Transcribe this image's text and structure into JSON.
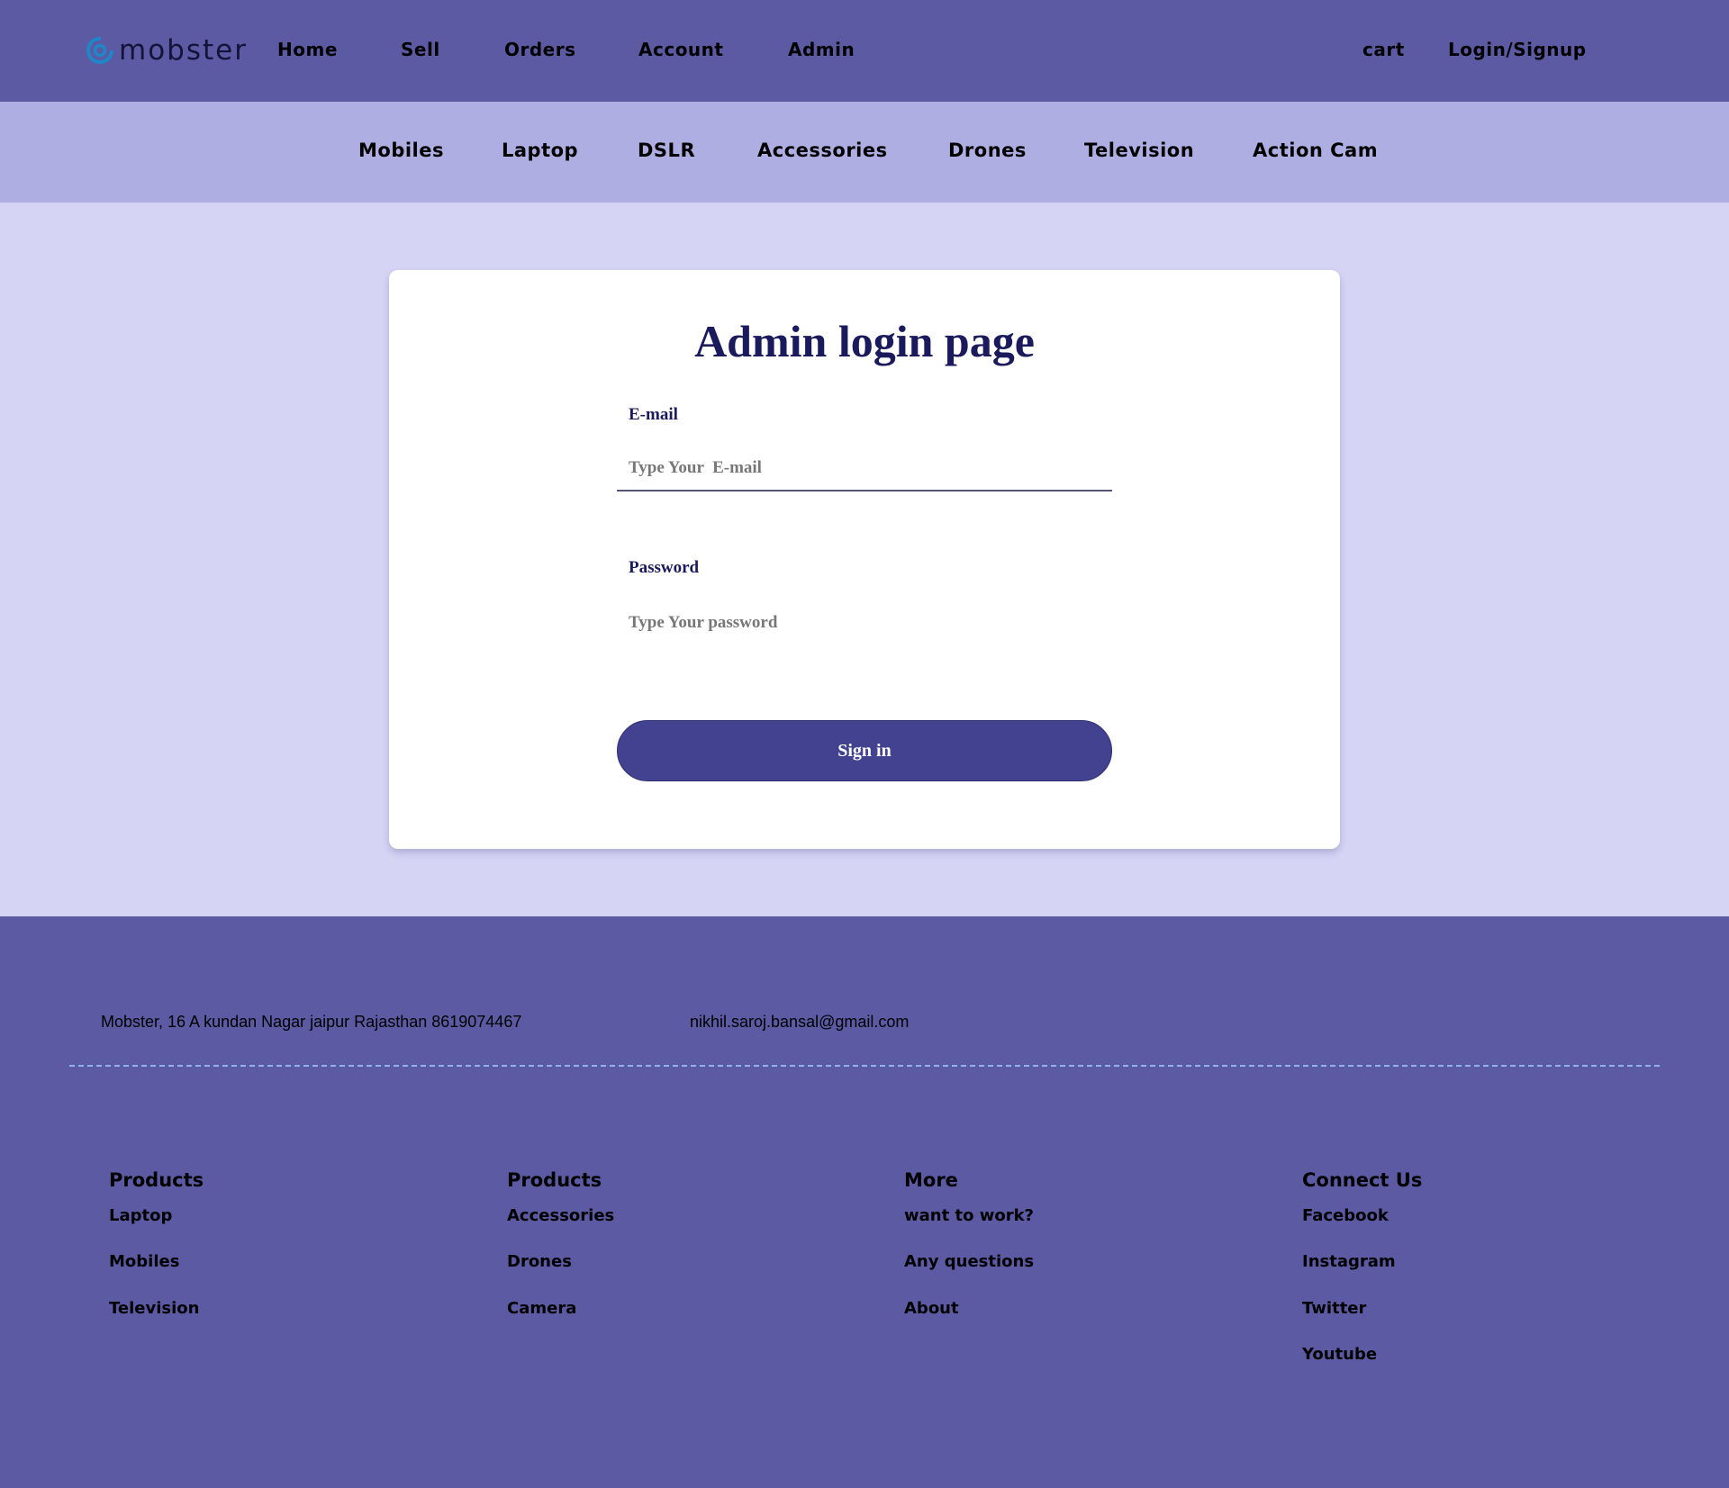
{
  "brand": {
    "name": "mobster",
    "icon": "at-swirl-logo-icon",
    "icon_color": "#1f86c8"
  },
  "topnav": {
    "links": [
      "Home",
      "Sell",
      "Orders",
      "Account",
      "Admin"
    ],
    "cart": "cart",
    "login": "Login/Signup"
  },
  "categories": [
    "Mobiles",
    "Laptop",
    "DSLR",
    "Accessories",
    "Drones",
    "Television",
    "Action Cam"
  ],
  "login_card": {
    "title": "Admin login page",
    "email_label": "E-mail",
    "email_placeholder": "Type Your  E-mail",
    "email_value": "",
    "password_label": "Password",
    "password_placeholder": "Type Your password",
    "password_value": "",
    "submit": "Sign in"
  },
  "footer": {
    "address": "Mobster, 16 A kundan Nagar jaipur Rajasthan  8619074467",
    "email": "nikhil.saroj.bansal@gmail.com",
    "columns": [
      {
        "title": "Products",
        "items": [
          "Laptop",
          "Mobiles",
          "Television"
        ]
      },
      {
        "title": "Products",
        "items": [
          "Accessories",
          "Drones",
          "Camera"
        ]
      },
      {
        "title": "More",
        "items": [
          "want to work?",
          "Any questions",
          "About"
        ]
      },
      {
        "title": "Connect Us",
        "items": [
          "Facebook",
          "Instagram",
          "Twitter",
          "Youtube"
        ]
      }
    ]
  },
  "colors": {
    "topnav_bg": "#5b5aa3",
    "category_bg": "#aeaee3",
    "page_bg": "#d5d4f5",
    "button_bg": "#424291",
    "title_color": "#1a1a5c"
  }
}
